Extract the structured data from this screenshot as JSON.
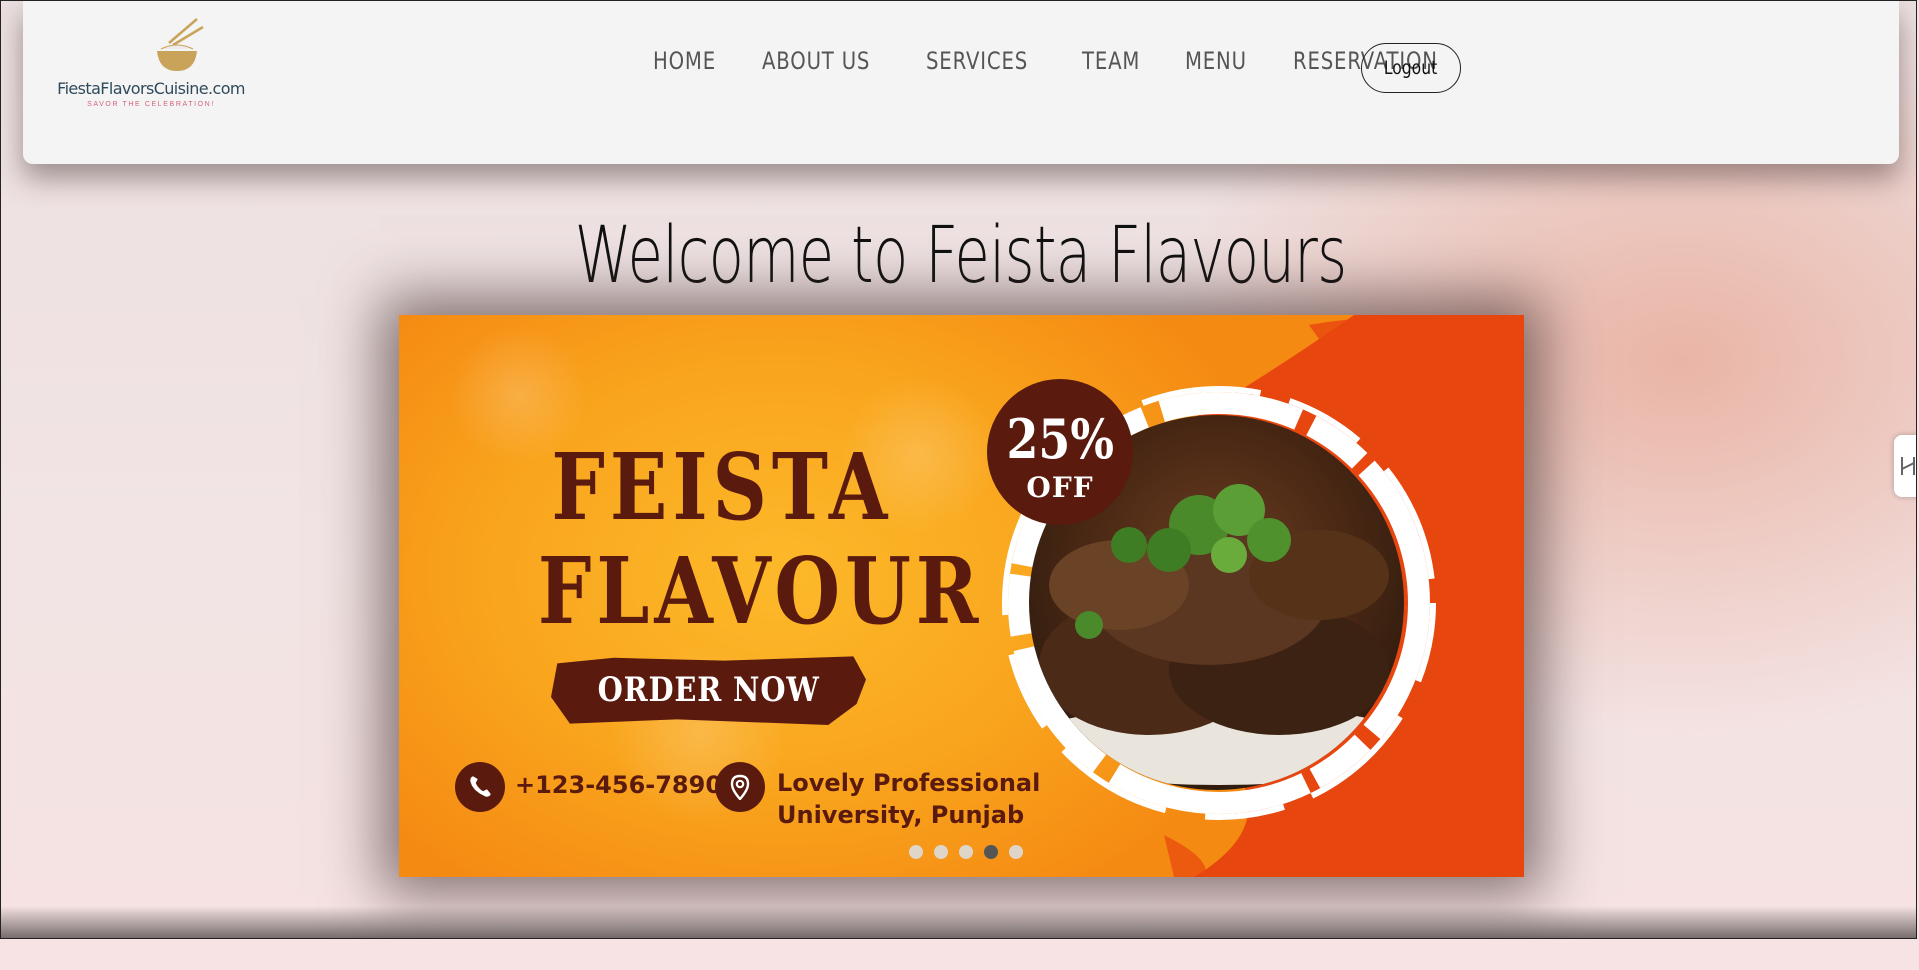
{
  "header": {
    "logo_name": "FiestaFlavorsCuisine.com",
    "logo_tagline": "SAVOR THE CELEBRATION!",
    "nav": [
      {
        "id": "home",
        "label": "HOME"
      },
      {
        "id": "about",
        "label": "ABOUT US"
      },
      {
        "id": "services",
        "label": "SERVICES"
      },
      {
        "id": "team",
        "label": "TEAM"
      },
      {
        "id": "menu",
        "label": "MENU"
      },
      {
        "id": "reservation",
        "label": "RESERVATION"
      }
    ],
    "logout_label": "Logout"
  },
  "welcome_title": "Welcome to Feista Flavours",
  "banner": {
    "title_line1": "FEISTA",
    "title_line2": "FLAVOUR",
    "order_button": "ORDER NOW",
    "discount_value": "25%",
    "discount_label": "OFF",
    "phone": "+123-456-7890",
    "address_line1": "Lovely Professional",
    "address_line2": "University, Punjab",
    "slide_count": 5,
    "active_slide_index": 3
  },
  "colors": {
    "brand_dark": "#5a1a0e",
    "banner_yellow": "#f9a51d",
    "banner_orange": "#e8460f",
    "logo_text": "#2f4a5b",
    "tagline": "#d4627c"
  },
  "icons": {
    "logo": "noodle-bowl-icon",
    "phone": "phone-icon",
    "location": "location-pin-icon",
    "side_tab": "side-tab-icon"
  }
}
